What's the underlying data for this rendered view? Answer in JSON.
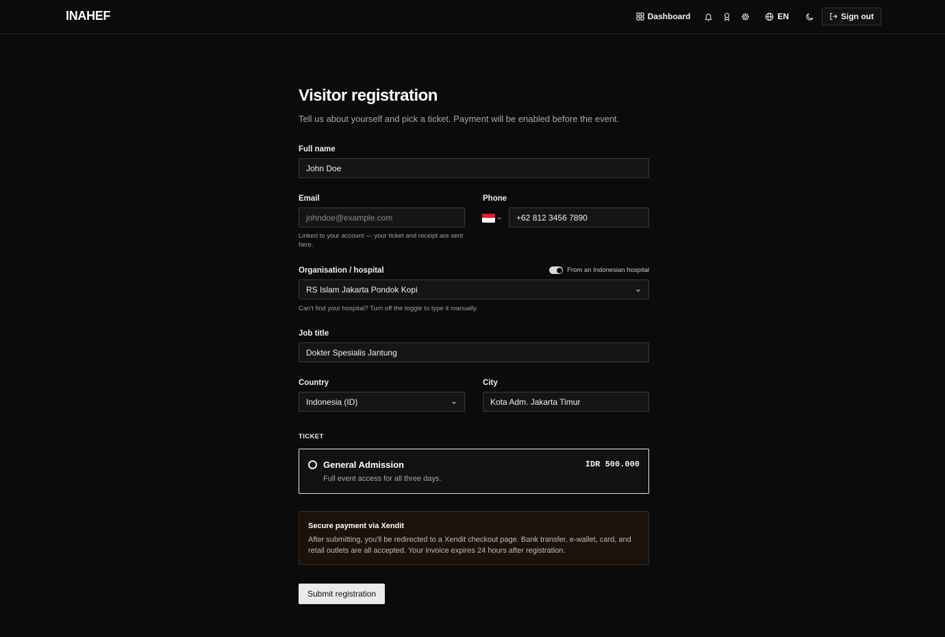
{
  "header": {
    "logo": "INAHEF",
    "nav": {
      "dashboard": "Dashboard",
      "language": "EN",
      "sign_out": "Sign out"
    }
  },
  "page": {
    "title": "Visitor registration",
    "subtitle": "Tell us about yourself and pick a ticket. Payment will be enabled before the event."
  },
  "form": {
    "full_name": {
      "label": "Full name",
      "value": "John Doe"
    },
    "email": {
      "label": "Email",
      "placeholder": "johndoe@example.com",
      "help": "Linked to your account — your ticket and receipt are sent here."
    },
    "phone": {
      "label": "Phone",
      "value": "+62 812 3456 7890"
    },
    "organisation": {
      "label": "Organisation / hospital",
      "toggle_label": "From an Indonesian hospital",
      "toggle_on": true,
      "value": "RS Islam Jakarta Pondok Kopi",
      "help": "Can't find your hospital? Turn off the toggle to type it manually."
    },
    "job_title": {
      "label": "Job title",
      "value": "Dokter Spesialis Jantung"
    },
    "country": {
      "label": "Country",
      "value": "Indonesia (ID)"
    },
    "city": {
      "label": "City",
      "value": "Kota Adm. Jakarta Timur"
    }
  },
  "ticket": {
    "section_label": "TICKET",
    "name": "General Admission",
    "description": "Full event access for all three days.",
    "price": "IDR 500.000"
  },
  "notice": {
    "title": "Secure payment via Xendit",
    "body": "After submitting, you'll be redirected to a Xendit checkout page. Bank transfer, e-wallet, card, and retail outlets are all accepted. Your invoice expires 24 hours after registration."
  },
  "submit_label": "Submit registration",
  "colors": {
    "background": "#0b0b0b",
    "notice_bg": "#1b120b",
    "notice_border": "#3e2a14",
    "flag_red": "#e11d22"
  }
}
